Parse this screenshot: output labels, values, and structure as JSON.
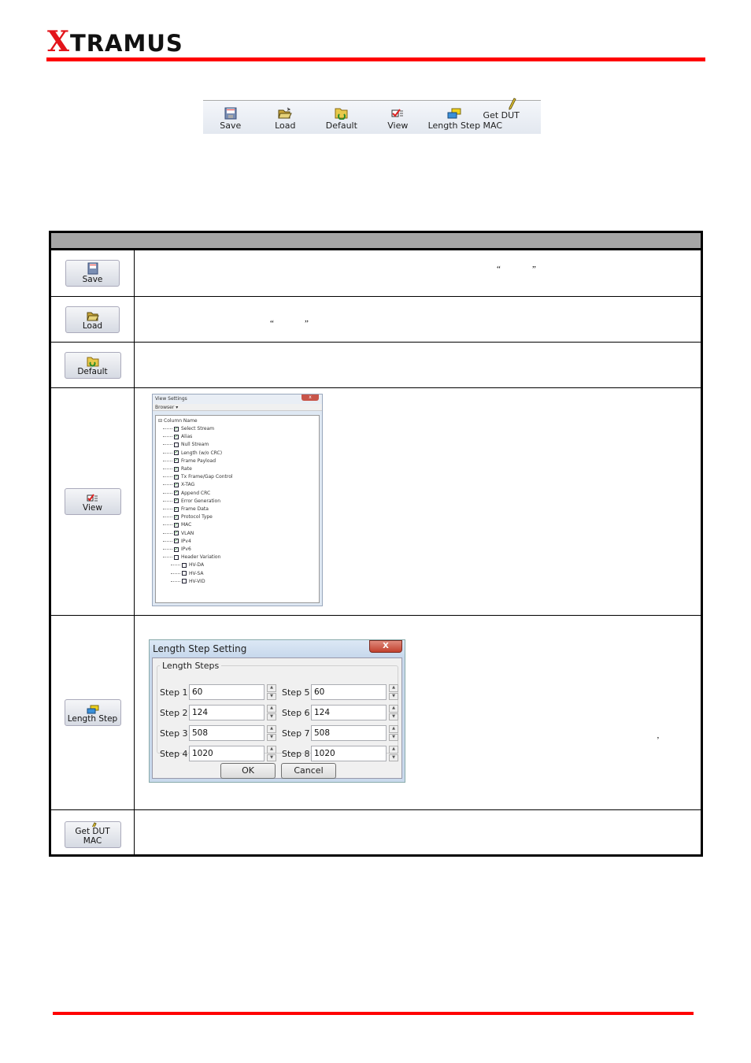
{
  "brand": {
    "logo_first": "X",
    "logo_rest": "TRAMUS",
    "accent": "#ff0000"
  },
  "toolbar": {
    "items": [
      {
        "label": "Save",
        "icon": "save-icon"
      },
      {
        "label": "Load",
        "icon": "folder-open-icon"
      },
      {
        "label": "Default",
        "icon": "folder-default-icon"
      },
      {
        "label": "View",
        "icon": "view-check-icon"
      },
      {
        "label": "Length Step",
        "icon": "length-step-icon"
      },
      {
        "label": "Get DUT MAC",
        "icon": "pencil-icon"
      }
    ]
  },
  "table": {
    "header": "",
    "rows": [
      {
        "button": "Save",
        "quote_open": "“",
        "quote_close": "”"
      },
      {
        "button": "Load",
        "quote_open": "“",
        "quote_close": "”"
      },
      {
        "button": "Default"
      },
      {
        "button": "View"
      },
      {
        "button": "Length Step",
        "comma": "’"
      },
      {
        "button": "Get DUT MAC"
      }
    ]
  },
  "view_settings": {
    "title": "View Settings",
    "close": "x",
    "menu": "Browser ▾",
    "root": "Column Name",
    "items": [
      {
        "label": "Select Stream",
        "checked": true
      },
      {
        "label": "Alias",
        "checked": true
      },
      {
        "label": "Null Stream",
        "checked": false
      },
      {
        "label": "Length (w/o CRC)",
        "checked": true
      },
      {
        "label": "Frame Payload",
        "checked": true
      },
      {
        "label": "Rate",
        "checked": true
      },
      {
        "label": "Tx Frame/Gap Control",
        "checked": true
      },
      {
        "label": "X-TAG",
        "checked": true
      },
      {
        "label": "Append CRC",
        "checked": true
      },
      {
        "label": "Error Generation",
        "checked": true
      },
      {
        "label": "Frame Data",
        "checked": true
      },
      {
        "label": "Protocol Type",
        "checked": true
      },
      {
        "label": "MAC",
        "checked": true
      },
      {
        "label": "VLAN",
        "checked": true
      },
      {
        "label": "IPv4",
        "checked": true
      },
      {
        "label": "IPv6",
        "checked": true
      },
      {
        "label": "Header Variation",
        "checked": false
      }
    ],
    "subitems": [
      {
        "label": "HV-DA",
        "checked": false
      },
      {
        "label": "HV-SA",
        "checked": false
      },
      {
        "label": "HV-VID",
        "checked": false
      }
    ]
  },
  "length_step": {
    "title": "Length Step Setting",
    "close": "X",
    "group": "Length Steps",
    "steps": [
      {
        "label": "Step 1",
        "value": "60"
      },
      {
        "label": "Step 2",
        "value": "124"
      },
      {
        "label": "Step 3",
        "value": "508"
      },
      {
        "label": "Step 4",
        "value": "1020"
      },
      {
        "label": "Step 5",
        "value": "60"
      },
      {
        "label": "Step 6",
        "value": "124"
      },
      {
        "label": "Step 7",
        "value": "508"
      },
      {
        "label": "Step 8",
        "value": "1020"
      }
    ],
    "ok": "OK",
    "cancel": "Cancel"
  }
}
